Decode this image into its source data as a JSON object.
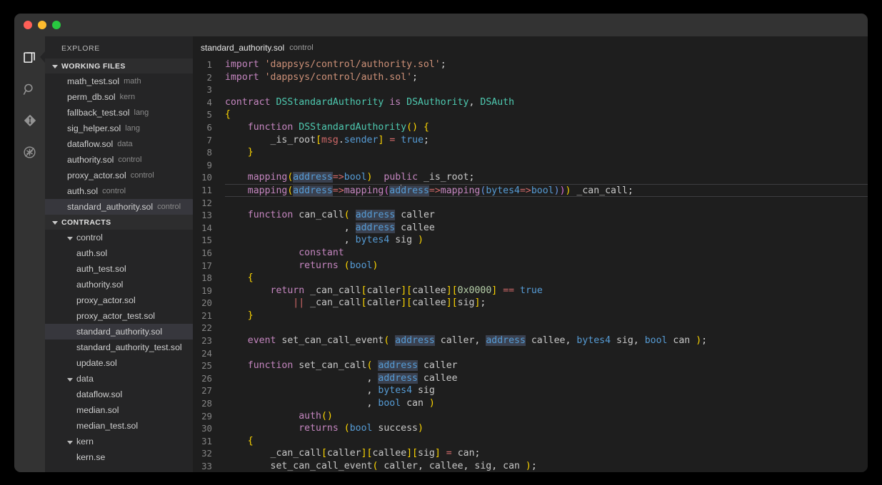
{
  "window": {
    "title": "",
    "traffic_lights": [
      {
        "name": "close",
        "color": "#ff5f57"
      },
      {
        "name": "minimize",
        "color": "#febc2e"
      },
      {
        "name": "maximize",
        "color": "#28c840"
      }
    ]
  },
  "activity_bar": {
    "items": [
      {
        "name": "explorer-icon",
        "label": "Explorer",
        "active": true
      },
      {
        "name": "search-icon",
        "label": "Search",
        "active": false
      },
      {
        "name": "source-control-icon",
        "label": "Source Control",
        "active": false
      },
      {
        "name": "debug-icon",
        "label": "Debug",
        "active": false
      }
    ]
  },
  "sidebar": {
    "title": "EXPLORE",
    "sections": [
      {
        "name": "working-files",
        "label": "WORKING FILES",
        "expanded": true,
        "items": [
          {
            "file": "math_test.sol",
            "meta": "math",
            "selected": false
          },
          {
            "file": "perm_db.sol",
            "meta": "kern",
            "selected": false
          },
          {
            "file": "fallback_test.sol",
            "meta": "lang",
            "selected": false
          },
          {
            "file": "sig_helper.sol",
            "meta": "lang",
            "selected": false
          },
          {
            "file": "dataflow.sol",
            "meta": "data",
            "selected": false
          },
          {
            "file": "authority.sol",
            "meta": "control",
            "selected": false
          },
          {
            "file": "proxy_actor.sol",
            "meta": "control",
            "selected": false
          },
          {
            "file": "auth.sol",
            "meta": "control",
            "selected": false
          },
          {
            "file": "standard_authority.sol",
            "meta": "control",
            "selected": true
          }
        ]
      },
      {
        "name": "contracts",
        "label": "CONTRACTS",
        "expanded": true,
        "folders": [
          {
            "name": "control",
            "expanded": true,
            "files": [
              {
                "file": "auth.sol",
                "selected": false
              },
              {
                "file": "auth_test.sol",
                "selected": false
              },
              {
                "file": "authority.sol",
                "selected": false
              },
              {
                "file": "proxy_actor.sol",
                "selected": false
              },
              {
                "file": "proxy_actor_test.sol",
                "selected": false
              },
              {
                "file": "standard_authority.sol",
                "selected": true
              },
              {
                "file": "standard_authority_test.sol",
                "selected": false
              },
              {
                "file": "update.sol",
                "selected": false
              }
            ]
          },
          {
            "name": "data",
            "expanded": true,
            "files": [
              {
                "file": "dataflow.sol",
                "selected": false
              },
              {
                "file": "median.sol",
                "selected": false
              },
              {
                "file": "median_test.sol",
                "selected": false
              }
            ]
          },
          {
            "name": "kern",
            "expanded": true,
            "files": [
              {
                "file": "kern.se",
                "selected": false
              }
            ]
          }
        ]
      }
    ]
  },
  "editor": {
    "breadcrumb": {
      "file": "standard_authority.sol",
      "folder": "control"
    },
    "active_line": 11,
    "first_line": 1,
    "last_line": 33,
    "lines": [
      {
        "n": 1,
        "code": "import 'dappsys/control/authority.sol';"
      },
      {
        "n": 2,
        "code": "import 'dappsys/control/auth.sol';"
      },
      {
        "n": 3,
        "code": ""
      },
      {
        "n": 4,
        "code": "contract DSStandardAuthority is DSAuthority, DSAuth"
      },
      {
        "n": 5,
        "code": "{"
      },
      {
        "n": 6,
        "code": "    function DSStandardAuthority() {"
      },
      {
        "n": 7,
        "code": "        _is_root[msg.sender] = true;"
      },
      {
        "n": 8,
        "code": "    }"
      },
      {
        "n": 9,
        "code": ""
      },
      {
        "n": 10,
        "code": "    mapping(address=>bool)  public _is_root;"
      },
      {
        "n": 11,
        "code": "    mapping(address=>mapping(address=>mapping(bytes4=>bool))) _can_call;"
      },
      {
        "n": 12,
        "code": ""
      },
      {
        "n": 13,
        "code": "    function can_call( address caller"
      },
      {
        "n": 14,
        "code": "                     , address callee"
      },
      {
        "n": 15,
        "code": "                     , bytes4 sig )"
      },
      {
        "n": 16,
        "code": "             constant"
      },
      {
        "n": 17,
        "code": "             returns (bool)"
      },
      {
        "n": 18,
        "code": "    {"
      },
      {
        "n": 19,
        "code": "        return _can_call[caller][callee][0x0000] == true"
      },
      {
        "n": 20,
        "code": "            || _can_call[caller][callee][sig];"
      },
      {
        "n": 21,
        "code": "    }"
      },
      {
        "n": 22,
        "code": ""
      },
      {
        "n": 23,
        "code": "    event set_can_call_event( address caller, address callee, bytes4 sig, bool can );"
      },
      {
        "n": 24,
        "code": ""
      },
      {
        "n": 25,
        "code": "    function set_can_call( address caller"
      },
      {
        "n": 26,
        "code": "                         , address callee"
      },
      {
        "n": 27,
        "code": "                         , bytes4 sig"
      },
      {
        "n": 28,
        "code": "                         , bool can )"
      },
      {
        "n": 29,
        "code": "             auth()"
      },
      {
        "n": 30,
        "code": "             returns (bool success)"
      },
      {
        "n": 31,
        "code": "    {"
      },
      {
        "n": 32,
        "code": "        _can_call[caller][callee][sig] = can;"
      },
      {
        "n": 33,
        "code": "        set_can_call_event( caller, callee, sig, can );"
      }
    ]
  },
  "colors": {
    "window_bg": "#1e1e1e",
    "titlebar_bg": "#333333",
    "activitybar_bg": "#333333",
    "sidebar_bg": "#252526",
    "selection_bg": "#37373d",
    "keyword": "#c586c0",
    "string": "#ce9178",
    "type": "#4ec9b0",
    "builtin_type": "#569cd6",
    "function_name": "#dcdcaa",
    "number": "#b5cea8",
    "operator": "#d16969",
    "line_number": "#858585",
    "word_highlight": "#3a4150"
  }
}
